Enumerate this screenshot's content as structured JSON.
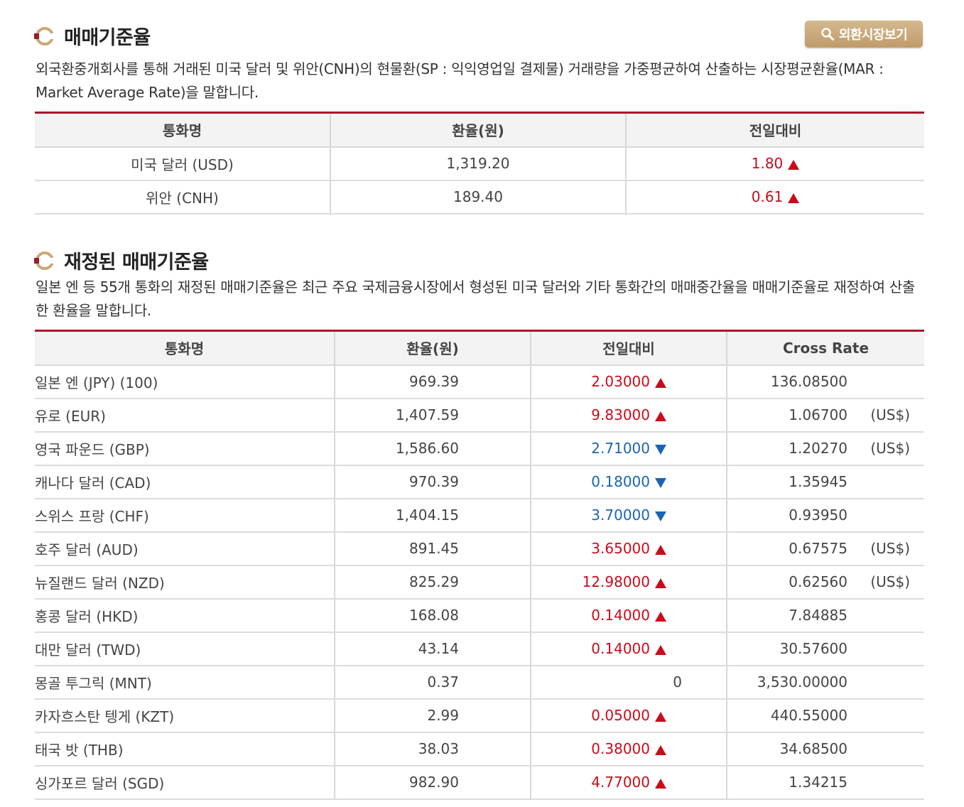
{
  "section1": {
    "title": "매매기준율",
    "button_label": "외환시장보기",
    "description": "외국환중개회사를 통해 거래된 미국 달러 및 위안(CNH)의 현물환(SP : 익익영업일 결제물) 거래량을 가중평균하여 산출하는 시장평균환율(MAR : Market Average Rate)을 말합니다.",
    "headers": [
      "통화명",
      "환율(원)",
      "전일대비"
    ],
    "rows": [
      {
        "name": "미국 달러 (USD)",
        "rate": "1,319.20",
        "change": "1.80",
        "dir": "up"
      },
      {
        "name": "위안 (CNH)",
        "rate": "189.40",
        "change": "0.61",
        "dir": "up"
      }
    ]
  },
  "section2": {
    "title": "재정된 매매기준율",
    "description": "일본 엔 등 55개 통화의 재정된 매매기준율은 최근 주요 국제금융시장에서 형성된 미국 달러와 기타 통화간의 매매중간율을 매매기준율로 재정하여 산출한 환율을 말합니다.",
    "headers": [
      "통화명",
      "환율(원)",
      "전일대비",
      "Cross Rate"
    ],
    "rows": [
      {
        "name": "일본 엔 (JPY) (100)",
        "rate": "969.39",
        "change": "2.03000",
        "dir": "up",
        "cross": "136.08500",
        "unit": ""
      },
      {
        "name": "유로 (EUR)",
        "rate": "1,407.59",
        "change": "9.83000",
        "dir": "up",
        "cross": "1.06700",
        "unit": "(US$)"
      },
      {
        "name": "영국 파운드 (GBP)",
        "rate": "1,586.60",
        "change": "2.71000",
        "dir": "down",
        "cross": "1.20270",
        "unit": "(US$)"
      },
      {
        "name": "캐나다 달러 (CAD)",
        "rate": "970.39",
        "change": "0.18000",
        "dir": "down",
        "cross": "1.35945",
        "unit": ""
      },
      {
        "name": "스위스 프랑 (CHF)",
        "rate": "1,404.15",
        "change": "3.70000",
        "dir": "down",
        "cross": "0.93950",
        "unit": ""
      },
      {
        "name": "호주 달러 (AUD)",
        "rate": "891.45",
        "change": "3.65000",
        "dir": "up",
        "cross": "0.67575",
        "unit": "(US$)"
      },
      {
        "name": "뉴질랜드 달러 (NZD)",
        "rate": "825.29",
        "change": "12.98000",
        "dir": "up",
        "cross": "0.62560",
        "unit": "(US$)"
      },
      {
        "name": "홍콩 달러 (HKD)",
        "rate": "168.08",
        "change": "0.14000",
        "dir": "up",
        "cross": "7.84885",
        "unit": ""
      },
      {
        "name": "대만 달러 (TWD)",
        "rate": "43.14",
        "change": "0.14000",
        "dir": "up",
        "cross": "30.57600",
        "unit": ""
      },
      {
        "name": "몽골 투그릭 (MNT)",
        "rate": "0.37",
        "change": "0",
        "dir": "none",
        "cross": "3,530.00000",
        "unit": ""
      },
      {
        "name": "카자흐스탄 텡게 (KZT)",
        "rate": "2.99",
        "change": "0.05000",
        "dir": "up",
        "cross": "440.55000",
        "unit": ""
      },
      {
        "name": "태국 밧 (THB)",
        "rate": "38.03",
        "change": "0.38000",
        "dir": "up",
        "cross": "34.68500",
        "unit": ""
      },
      {
        "name": "싱가포르 달러 (SGD)",
        "rate": "982.90",
        "change": "4.77000",
        "dir": "up",
        "cross": "1.34215",
        "unit": ""
      }
    ]
  },
  "colors": {
    "up": "#cc0a1a",
    "down": "#1a64b4",
    "accent": "#a3182b",
    "button": "#c9a877"
  },
  "icons": {
    "section_bullet": "section-bullet-icon",
    "search": "search-icon",
    "up": "triangle-up-icon",
    "down": "triangle-down-icon"
  }
}
